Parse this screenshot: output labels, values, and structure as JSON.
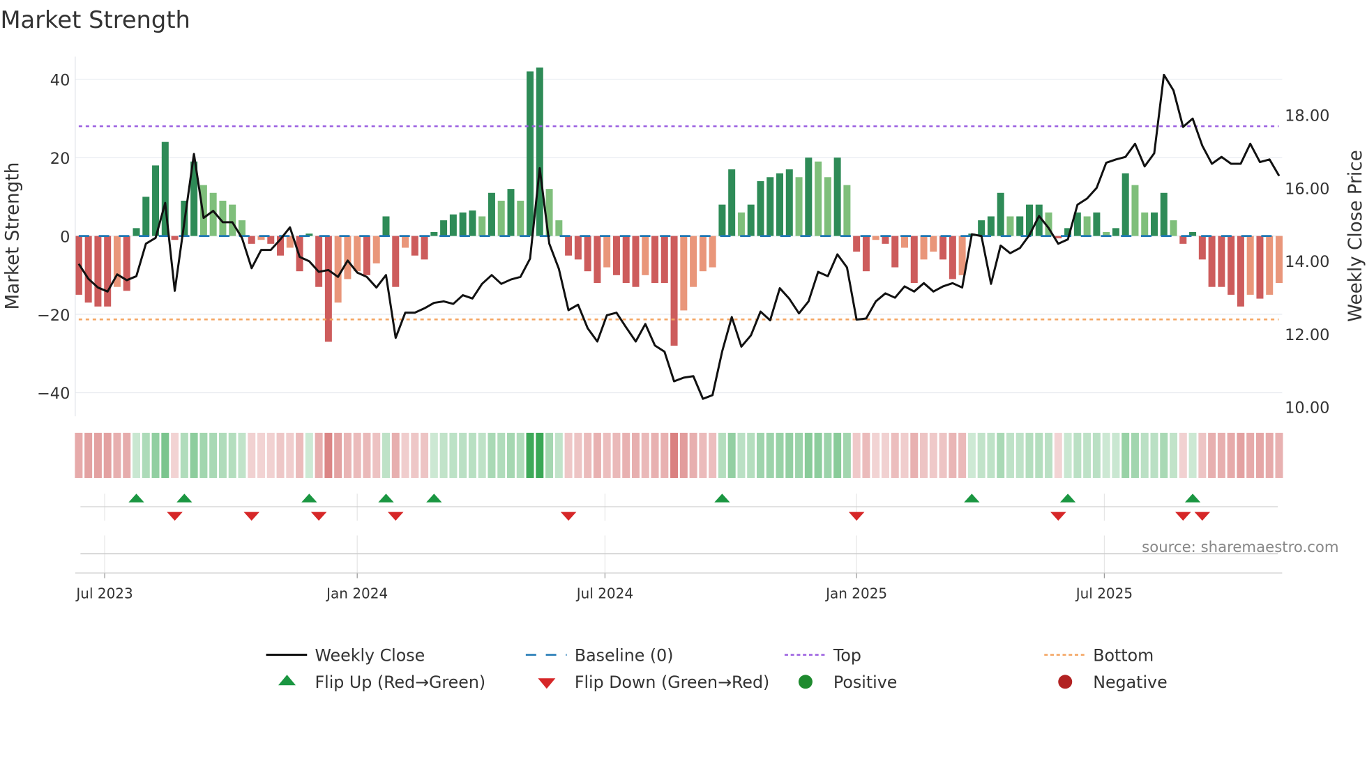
{
  "chart_data": {
    "type": "bar",
    "title": "Market Strength",
    "ylabel": "Market Strength",
    "y2label": "Weekly Close Price",
    "ylim": [
      -46,
      46
    ],
    "y2lim": [
      9.7,
      19.8
    ],
    "yticks": [
      40,
      20,
      0,
      -20,
      -40
    ],
    "yticklabels": [
      "40",
      "20",
      "0",
      "−20",
      "−40"
    ],
    "y2ticks": [
      18,
      16,
      14,
      12,
      10
    ],
    "y2ticklabels": [
      "18.00",
      "16.00",
      "14.00",
      "12.00",
      "10.00"
    ],
    "xticks": [
      {
        "label": "Jul 2023",
        "week_index": 2.7
      },
      {
        "label": "Jan 2024",
        "week_index": 29
      },
      {
        "label": "Jul 2024",
        "week_index": 54.8
      },
      {
        "label": "Jan 2025",
        "week_index": 81
      },
      {
        "label": "Jul 2025",
        "week_index": 106.8
      }
    ],
    "top_level": 28,
    "bottom_level": -21.3,
    "baseline": 0,
    "strength": [
      -15,
      -17,
      -18,
      -18,
      -13,
      -14,
      2,
      10,
      18,
      24,
      -1,
      9,
      19,
      13,
      11,
      9,
      8,
      4,
      -2,
      -1,
      -2,
      -5,
      -3,
      -9,
      0.6,
      -13,
      -27,
      -17,
      -11,
      -9,
      -10,
      -7,
      5,
      -13,
      -3,
      -5,
      -6,
      1,
      4,
      5.5,
      6,
      6.5,
      5,
      11,
      9,
      12,
      9,
      42,
      43,
      12,
      4,
      -5,
      -6,
      -9,
      -12,
      -8,
      -10,
      -12,
      -13,
      -10,
      -12,
      -12,
      -28,
      -19,
      -13,
      -9,
      -8,
      8,
      17,
      6,
      8,
      14,
      15,
      16,
      17,
      15,
      20,
      19,
      15,
      20,
      13,
      -4,
      -9,
      -1,
      -2,
      -8,
      -3,
      -12,
      -6,
      -4,
      -6,
      -11,
      -10,
      0.6,
      4,
      5,
      11,
      5,
      5,
      8,
      8,
      6,
      -0.6,
      2,
      6,
      5,
      6,
      1,
      2,
      16,
      13,
      6,
      6,
      11,
      4,
      -2,
      1,
      -6,
      -13,
      -13,
      -15,
      -18,
      -15,
      -16,
      -15,
      -12
    ],
    "weekly_close": [
      13.92,
      13.51,
      13.27,
      13.16,
      13.63,
      13.47,
      13.58,
      14.47,
      14.63,
      15.59,
      13.18,
      15.06,
      16.93,
      15.18,
      15.37,
      15.06,
      15.06,
      14.63,
      13.8,
      14.3,
      14.3,
      14.59,
      14.92,
      14.11,
      13.99,
      13.7,
      13.75,
      13.56,
      14.01,
      13.68,
      13.56,
      13.27,
      13.61,
      11.89,
      12.58,
      12.58,
      12.7,
      12.85,
      12.89,
      12.82,
      13.06,
      12.97,
      13.37,
      13.61,
      13.37,
      13.49,
      13.56,
      14.06,
      16.54,
      14.47,
      13.78,
      12.65,
      12.8,
      12.15,
      11.79,
      12.51,
      12.58,
      12.18,
      11.79,
      12.27,
      11.68,
      11.51,
      10.7,
      10.8,
      10.84,
      10.22,
      10.32,
      11.51,
      12.46,
      11.65,
      11.96,
      12.61,
      12.37,
      13.25,
      12.96,
      12.56,
      12.89,
      13.7,
      13.58,
      14.18,
      13.82,
      12.39,
      12.42,
      12.89,
      13.11,
      12.99,
      13.3,
      13.16,
      13.39,
      13.16,
      13.3,
      13.39,
      13.27,
      14.73,
      14.68,
      13.37,
      14.42,
      14.21,
      14.35,
      14.71,
      15.23,
      14.9,
      14.47,
      14.59,
      15.54,
      15.71,
      16.0,
      16.69,
      16.78,
      16.85,
      17.21,
      16.59,
      16.95,
      19.1,
      18.67,
      17.67,
      17.9,
      17.16,
      16.66,
      16.85,
      16.66,
      16.66,
      17.21,
      16.71,
      16.78,
      16.33
    ],
    "legend": [
      {
        "label": "Weekly Close",
        "kind": "line",
        "color": "#111111"
      },
      {
        "label": "Baseline (0)",
        "kind": "dash",
        "color": "#1f77b4"
      },
      {
        "label": "Top",
        "kind": "dot",
        "color": "#9b5fe0"
      },
      {
        "label": "Bottom",
        "kind": "dot",
        "color": "#f4a460"
      },
      {
        "label": "Flip Up (Red→Green)",
        "kind": "tri-up",
        "color": "#1a9641"
      },
      {
        "label": "Flip Down (Green→Red)",
        "kind": "tri-down",
        "color": "#d62728"
      },
      {
        "label": "Positive",
        "kind": "circle",
        "color": "#1e8a2e"
      },
      {
        "label": "Negative",
        "kind": "circle",
        "color": "#b22222"
      }
    ],
    "legend_placement": "bottom",
    "colors": {
      "pos_strong": "#2e8b57",
      "pos_weak": "#7fbf7b",
      "neg_strong": "#cd5c5c",
      "neg_weak": "#e9967a"
    },
    "source": "source: sharemaestro.com"
  }
}
